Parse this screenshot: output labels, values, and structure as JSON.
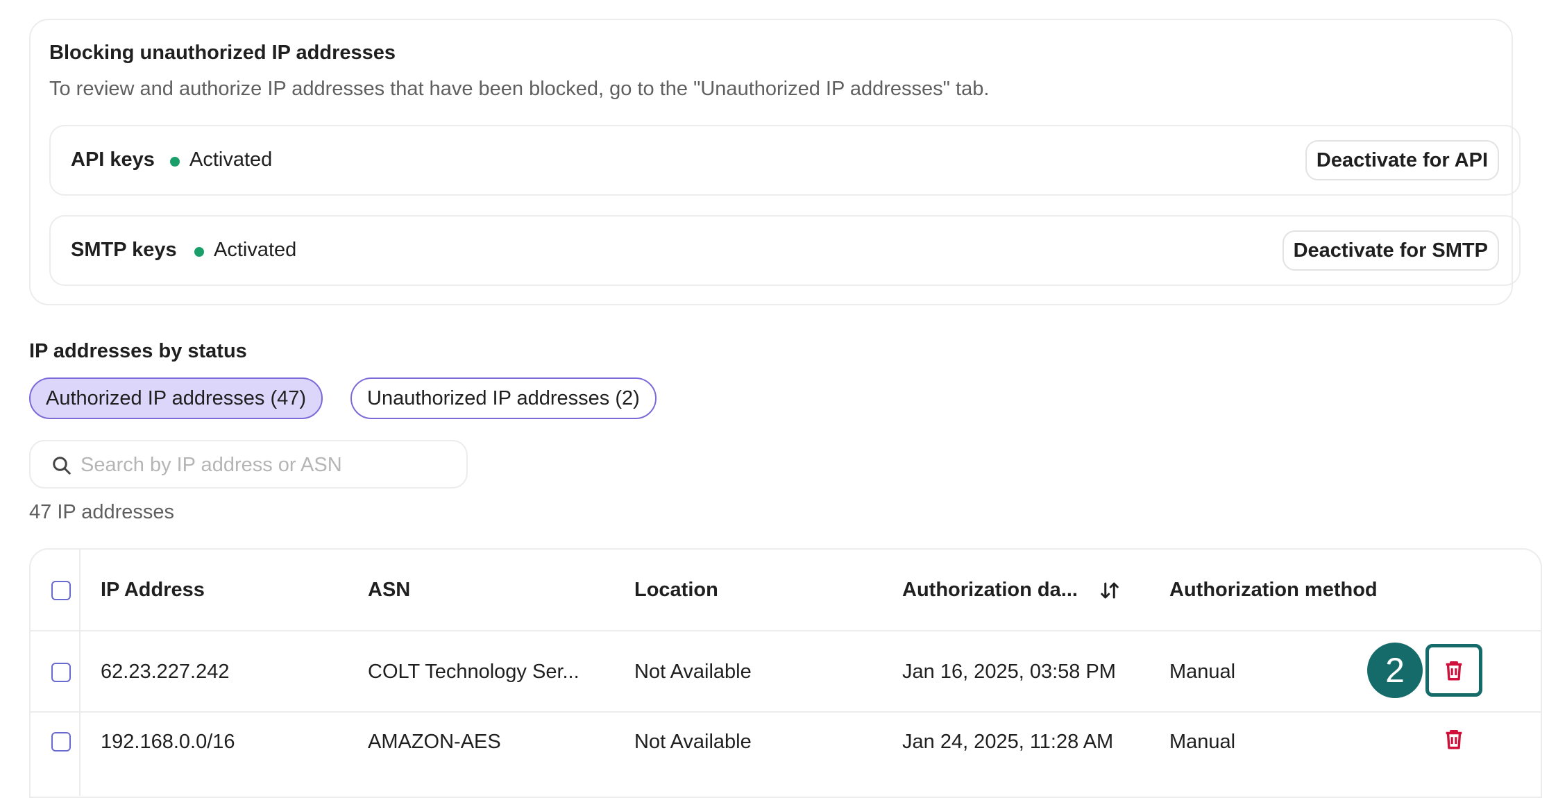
{
  "blocking": {
    "title": "Blocking unauthorized IP addresses",
    "description": "To review and authorize IP addresses that have been blocked, go to the \"Unauthorized IP addresses\" tab.",
    "api": {
      "name": "API keys",
      "status": "Activated",
      "button": "Deactivate for API"
    },
    "smtp": {
      "name": "SMTP keys",
      "status": "Activated",
      "button": "Deactivate for SMTP"
    },
    "status_color": "#1a9e6a"
  },
  "status_section": {
    "title": "IP addresses by status",
    "tabs": [
      {
        "label": "Authorized IP addresses (47)",
        "active": true
      },
      {
        "label": "Unauthorized IP addresses (2)",
        "active": false
      }
    ]
  },
  "search": {
    "placeholder": "Search by IP address or ASN",
    "value": ""
  },
  "count_label": "47 IP addresses",
  "table": {
    "headers": [
      "IP Address",
      "ASN",
      "Location",
      "Authorization da...",
      "Authorization method"
    ],
    "rows": [
      {
        "ip": "62.23.227.242",
        "asn": "COLT Technology Ser...",
        "location": "Not Available",
        "date": "Jan 16, 2025, 03:58 PM",
        "method": "Manual"
      },
      {
        "ip": "192.168.0.0/16",
        "asn": "AMAZON-AES",
        "location": "Not Available",
        "date": "Jan 24, 2025, 11:28 AM",
        "method": "Manual"
      }
    ]
  },
  "step_badge": "2",
  "colors": {
    "accent": "#7b6ad8",
    "active_pill": "#dcd6fb",
    "trash": "#d0103a",
    "badge": "#156b69"
  }
}
